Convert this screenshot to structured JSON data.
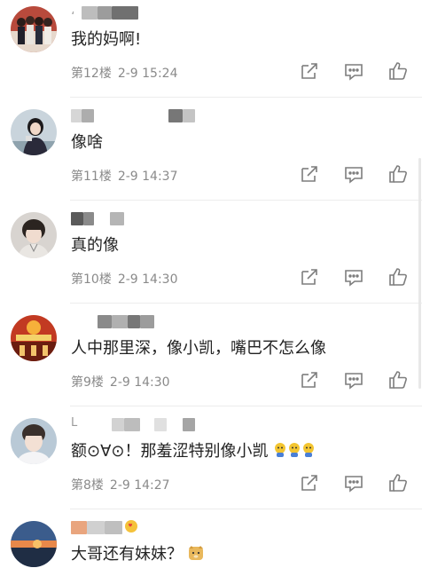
{
  "comments": [
    {
      "content": "我的妈啊!",
      "floor": "第12楼",
      "time": "2-9 15:24",
      "name_prefix": "،",
      "avatar": "group-photo-avatar"
    },
    {
      "content": "像啥",
      "floor": "第11楼",
      "time": "2-9 14:37",
      "name_prefix": "",
      "avatar": "girl-photo-avatar"
    },
    {
      "content": "真的像",
      "floor": "第10楼",
      "time": "2-9 14:30",
      "name_prefix": "",
      "avatar": "boy-photo-avatar"
    },
    {
      "content": "人中那里深，像小凯，嘴巴不怎么像",
      "floor": "第9楼",
      "time": "2-9 14:30",
      "name_prefix": "",
      "avatar": "stage-photo-avatar"
    },
    {
      "content": "额⊙∀⊙！那羞涩特别像小凯",
      "floor": "第8楼",
      "time": "2-9 14:27",
      "name_prefix": "L",
      "avatar": "young-man-avatar"
    },
    {
      "content": "大哥还有妹妹？",
      "floor": "",
      "time": "",
      "name_prefix": "",
      "avatar": "sunset-avatar"
    }
  ],
  "icons": {
    "share": "share-icon",
    "reply": "reply-icon",
    "like": "like-icon",
    "emoji_face": "crying-face-emoji",
    "emoji_dog": "doge-emoji",
    "emoji_heart": "heart-face-emoji"
  },
  "colors": {
    "text": "#222222",
    "meta": "#8a8a8a",
    "icon": "#7d7d7d",
    "divider": "#ececec"
  }
}
